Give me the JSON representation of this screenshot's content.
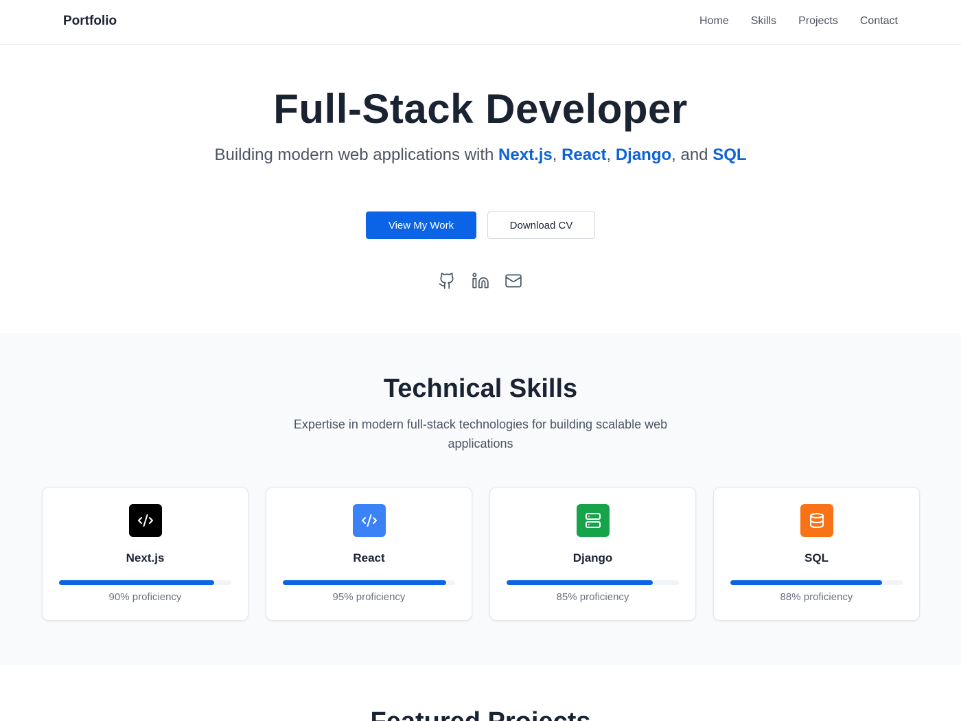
{
  "header": {
    "brand": "Portfolio",
    "nav": [
      "Home",
      "Skills",
      "Projects",
      "Contact"
    ]
  },
  "hero": {
    "title": "Full-Stack Developer",
    "subtitle_prefix": "Building modern web applications with ",
    "tech": [
      "Next.js",
      "React",
      "Django",
      "SQL"
    ],
    "sep_comma": ", ",
    "sep_and": ", and ",
    "primary_button": "View My Work",
    "secondary_button": "Download CV",
    "social_icons": [
      "github-icon",
      "linkedin-icon",
      "mail-icon"
    ]
  },
  "skills": {
    "title": "Technical Skills",
    "subtitle": "Expertise in modern full-stack technologies for building scalable web applications",
    "cards": [
      {
        "name": "Next.js",
        "proficiency": 90,
        "label": "90% proficiency",
        "icon": "code-icon",
        "color": "#000000"
      },
      {
        "name": "React",
        "proficiency": 95,
        "label": "95% proficiency",
        "icon": "code-icon",
        "color": "#3b82f6"
      },
      {
        "name": "Django",
        "proficiency": 85,
        "label": "85% proficiency",
        "icon": "server-icon",
        "color": "#16a34a"
      },
      {
        "name": "SQL",
        "proficiency": 88,
        "label": "88% proficiency",
        "icon": "database-icon",
        "color": "#f97316"
      }
    ]
  },
  "projects": {
    "title": "Featured Projects"
  },
  "colors": {
    "accent": "#0b63e5",
    "text": "#1a2332",
    "muted": "#4b5563"
  }
}
